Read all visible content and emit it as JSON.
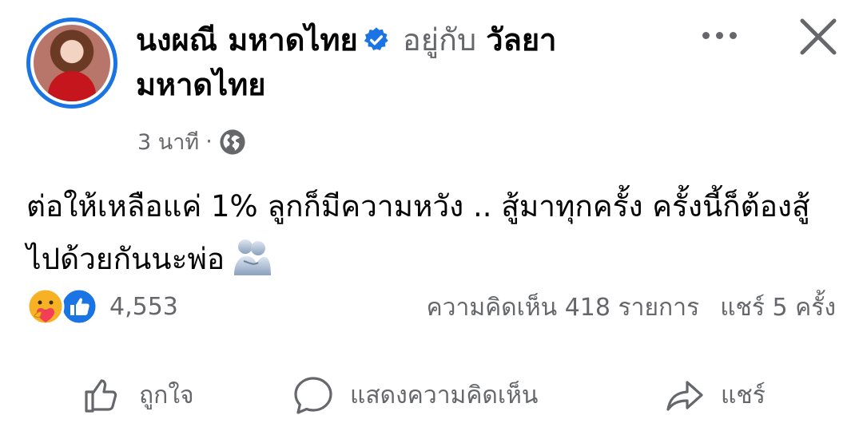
{
  "post": {
    "author_name": "นงผณี มหาดไทย",
    "with_label": "อยู่กับ",
    "tagged_name": "วัลยา มหาดไทย",
    "time": "3 นาที",
    "separator": "·",
    "privacy_icon": "globe-icon",
    "body": "ต่อให้เหลือแค่ 1% ลูกก็มีความหวัง .. สู้มาทุกครั้ง ครั้งนี้ก็ต้องสู้ไปด้วยกันนะพ่อ",
    "emoji": "people-hugging-emoji"
  },
  "engagement": {
    "reaction_icons": [
      "care-reaction-icon",
      "like-reaction-icon"
    ],
    "reaction_count": "4,553",
    "comments": "ความคิดเห็น 418 รายการ",
    "shares": "แชร์ 5 ครั้ง"
  },
  "actions": {
    "like": "ถูกใจ",
    "comment": "แสดงความคิดเห็น",
    "share": "แชร์"
  },
  "colors": {
    "accent": "#1b74e4",
    "secondary_text": "#65676b",
    "primary_text": "#050505"
  }
}
